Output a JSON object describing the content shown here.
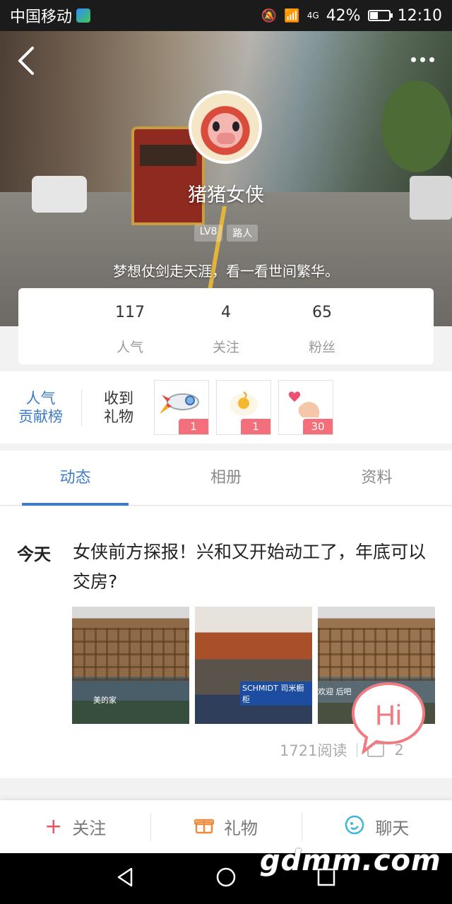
{
  "status_bar": {
    "carrier": "中国移动",
    "network": "4G",
    "battery": "42%",
    "battery_level": 0.42,
    "time": "12:10"
  },
  "header": {
    "back_icon": "back-chevron-icon",
    "more_icon": "more-dots-icon"
  },
  "profile": {
    "username": "猪猪女侠",
    "badges": [
      "LV8",
      "路人"
    ],
    "motto": "梦想仗剑走天涯，看一看世间繁华。"
  },
  "stats": [
    {
      "value": "117",
      "label": "人气"
    },
    {
      "value": "4",
      "label": "关注"
    },
    {
      "value": "65",
      "label": "粉丝"
    }
  ],
  "gifts": {
    "rank_link": [
      "人气",
      "贡献榜"
    ],
    "received_label": [
      "收到",
      "礼物"
    ],
    "items": [
      {
        "icon": "rocket-icon",
        "count": "1"
      },
      {
        "icon": "egg-icon",
        "count": "1"
      },
      {
        "icon": "finger-heart-icon",
        "count": "30"
      }
    ]
  },
  "tabs": [
    {
      "label": "动态",
      "active": true
    },
    {
      "label": "相册",
      "active": false
    },
    {
      "label": "资料",
      "active": false
    }
  ],
  "post": {
    "day": "今天",
    "text": "女侠前方探报！兴和又开始动工了，年底可以交房?",
    "photo_captions": [
      "美的家",
      "SCHMIDT 司米橱柜",
      "欢迎 后吧"
    ],
    "reads": "1721阅读",
    "shares": "2"
  },
  "hi_bubble": {
    "label": "Hi"
  },
  "actions": [
    {
      "icon": "plus-icon",
      "label": "关注"
    },
    {
      "icon": "gift-icon",
      "label": "礼物"
    },
    {
      "icon": "chat-icon",
      "label": "聊天"
    }
  ],
  "watermark": "gdmm.com",
  "colors": {
    "accent": "#3e7cc6",
    "gift_badge": "#f36f7b",
    "hi_bubble": "#f07b82",
    "follow_icon": "#e8545f",
    "gift_icon": "#f08a3c",
    "chat_icon": "#3cb7d6"
  }
}
